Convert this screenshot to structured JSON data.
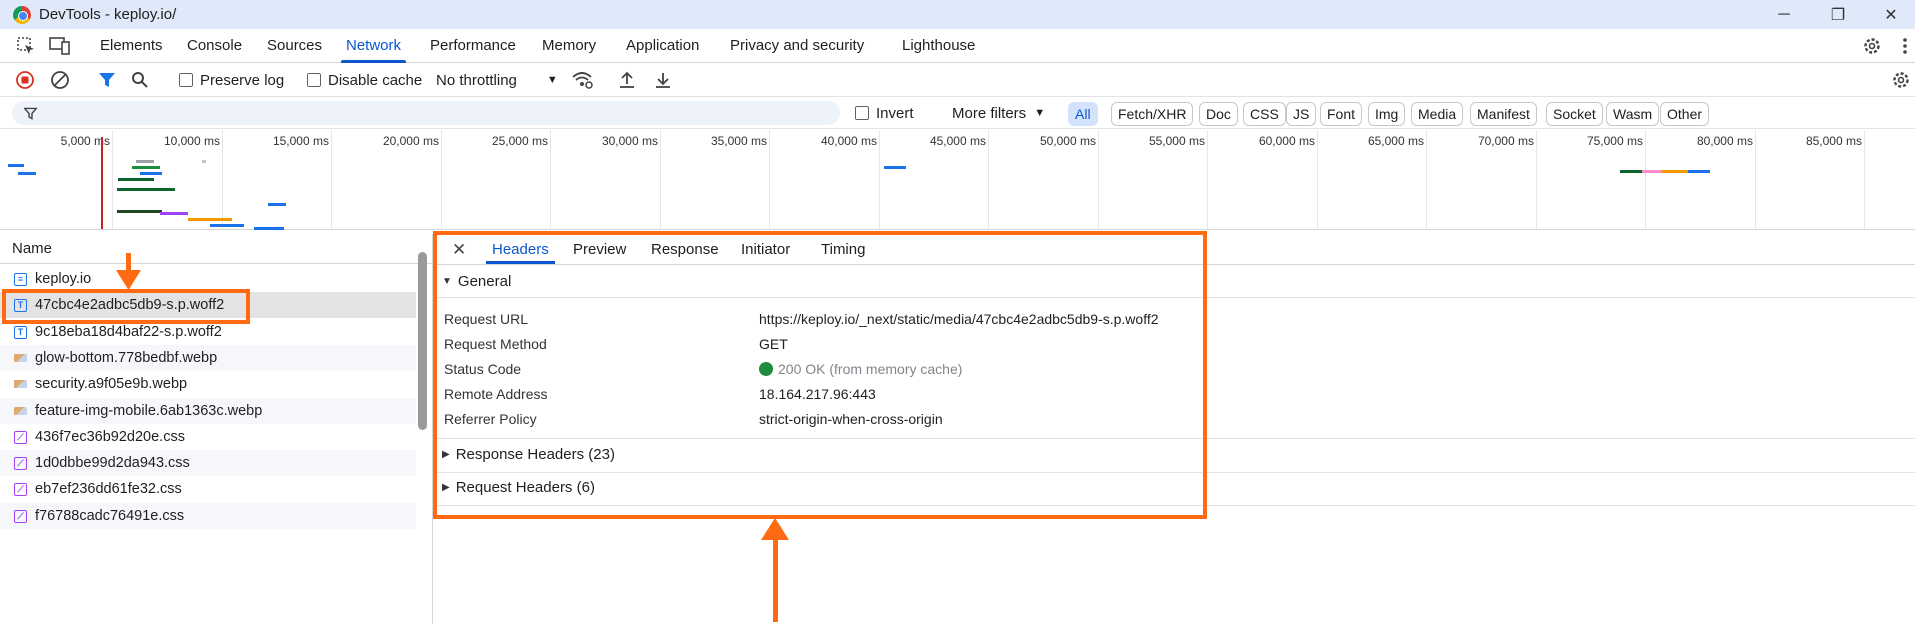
{
  "window": {
    "title": "DevTools - keploy.io/"
  },
  "tabs": [
    "Elements",
    "Console",
    "Sources",
    "Network",
    "Performance",
    "Memory",
    "Application",
    "Privacy and security",
    "Lighthouse"
  ],
  "active_tab": "Network",
  "toolbar": {
    "preserve_log": "Preserve log",
    "disable_cache": "Disable cache",
    "throttling": "No throttling"
  },
  "filter": {
    "invert": "Invert",
    "more_filters": "More filters",
    "types": [
      "All",
      "Fetch/XHR",
      "Doc",
      "CSS",
      "JS",
      "Font",
      "Img",
      "Media",
      "Manifest",
      "Socket",
      "Wasm",
      "Other"
    ],
    "active_type": "All"
  },
  "overview": {
    "ticks": [
      "5,000 ms",
      "10,000 ms",
      "15,000 ms",
      "20,000 ms",
      "25,000 ms",
      "30,000 ms",
      "35,000 ms",
      "40,000 ms",
      "45,000 ms",
      "50,000 ms",
      "55,000 ms",
      "60,000 ms",
      "65,000 ms",
      "70,000 ms",
      "75,000 ms",
      "80,000 ms",
      "85,000 ms"
    ]
  },
  "list": {
    "header": "Name",
    "rows": [
      {
        "name": "keploy.io",
        "type": "doc"
      },
      {
        "name": "47cbc4e2adbc5db9-s.p.woff2",
        "type": "font"
      },
      {
        "name": "9c18eba18d4baf22-s.p.woff2",
        "type": "font"
      },
      {
        "name": "glow-bottom.778bedbf.webp",
        "type": "img"
      },
      {
        "name": "security.a9f05e9b.webp",
        "type": "img"
      },
      {
        "name": "feature-img-mobile.6ab1363c.webp",
        "type": "img"
      },
      {
        "name": "436f7ec36b92d20e.css",
        "type": "css"
      },
      {
        "name": "1d0dbbe99d2da943.css",
        "type": "css"
      },
      {
        "name": "eb7ef236dd61fe32.css",
        "type": "css"
      },
      {
        "name": "f76788cadc76491e.css",
        "type": "css"
      }
    ]
  },
  "details": {
    "close": "✕",
    "tabs": [
      "Headers",
      "Preview",
      "Response",
      "Initiator",
      "Timing"
    ],
    "active_tab": "Headers",
    "general_title": "General",
    "general": [
      {
        "key": "Request URL",
        "value": "https://keploy.io/_next/static/media/47cbc4e2adbc5db9-s.p.woff2"
      },
      {
        "key": "Request Method",
        "value": "GET"
      },
      {
        "key": "Status Code",
        "value": "200 OK (from memory cache)"
      },
      {
        "key": "Remote Address",
        "value": "18.164.217.96:443"
      },
      {
        "key": "Referrer Policy",
        "value": "strict-origin-when-cross-origin"
      }
    ],
    "response_headers": "Response Headers (23)",
    "request_headers": "Request Headers (6)"
  },
  "colors": {
    "accent": "#0b57d0",
    "annotation": "#ff6a13",
    "status_ok": "#1e8e3e"
  }
}
